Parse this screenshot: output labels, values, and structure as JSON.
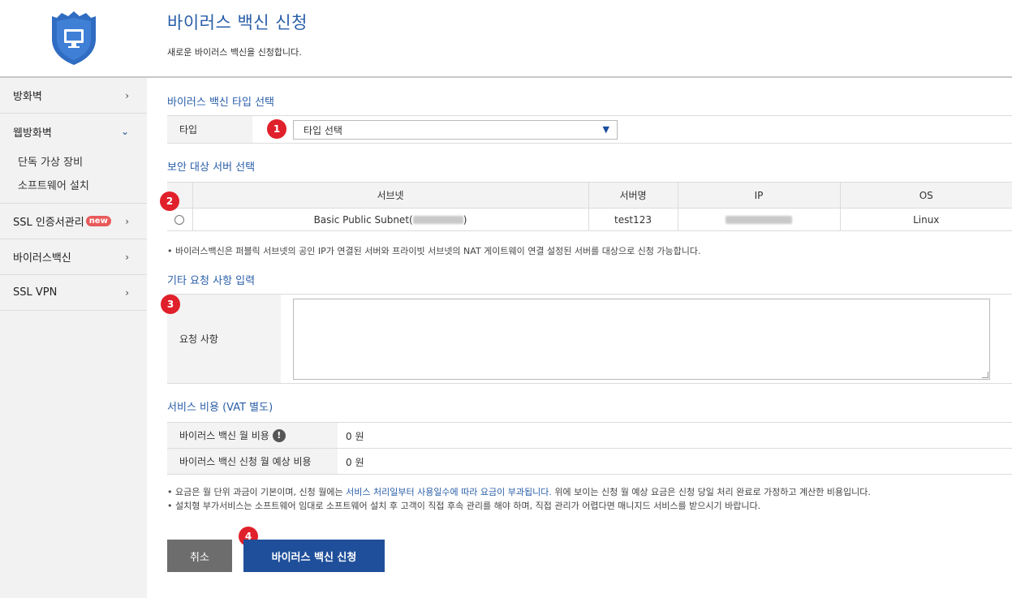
{
  "sidebar": {
    "items": [
      {
        "label": "방화벽"
      },
      {
        "label": "웹방화벽",
        "sub": [
          "단독 가상 장비",
          "소프트웨어 설치"
        ]
      },
      {
        "label": "SSL 인증서관리",
        "badge": "new"
      },
      {
        "label": "바이러스백신"
      },
      {
        "label": "SSL VPN"
      }
    ]
  },
  "header": {
    "title": "바이러스 백신 신청",
    "subtitle": "새로운 바이러스 백신을 신청합니다."
  },
  "type_section": {
    "title": "바이러스 백신 타입 선택",
    "label": "타입",
    "select_value": "타입 선택"
  },
  "server_section": {
    "title": "보안 대상 서버 선택",
    "columns": [
      "서브넷",
      "서버명",
      "IP",
      "OS"
    ],
    "rows": [
      {
        "subnet_prefix": "Basic Public Subnet(",
        "subnet_suffix": ")",
        "name": "test123",
        "os": "Linux"
      }
    ],
    "note": "• 바이러스백신은 퍼블릭 서브넷의 공인 IP가 연결된 서버와 프라이빗 서브넷의 NAT 게이트웨이 연결 설정된 서버를 대상으로 신청 가능합니다."
  },
  "request_section": {
    "title": "기타 요청 사항 입력",
    "label": "요청 사항",
    "value": ""
  },
  "cost_section": {
    "title": "서비스 비용 (VAT 별도)",
    "monthly_label": "바이러스 백신 월 비용",
    "monthly_value": "0 원",
    "expected_label": "바이러스 백신 신청 월 예상 비용",
    "expected_value": "0 원",
    "note1_a": "• 요금은 월 단위 과금이 기본이며, 신청 월에는 ",
    "note1_hl": "서비스 처리일부터 사용일수에 따라 요금이 부과됩니다.",
    "note1_b": " 위에 보이는 신청 월 예상 요금은 신청 당일 처리 완료로 가정하고 계산한 비용입니다.",
    "note2": "• 설치형 부가서비스는 소프트웨어 임대로 소프트웨어 설치 후 고객이 직접 후속 관리를 해야 하며, 직접 관리가 어렵다면 매니지드 서비스를 받으시기 바랍니다."
  },
  "buttons": {
    "cancel": "취소",
    "submit": "바이러스 백신 신청"
  },
  "markers": [
    "1",
    "2",
    "3",
    "4"
  ],
  "icons": {
    "logo": "shield-monitor-icon",
    "chevron_right": "›",
    "chevron_down": "⌄",
    "info": "!"
  },
  "colors": {
    "accent": "#2a5ea8",
    "primary_button": "#1f4f9a",
    "cancel_button": "#6d6d6d",
    "marker": "#e0202a",
    "badge": "#e85a5a"
  }
}
